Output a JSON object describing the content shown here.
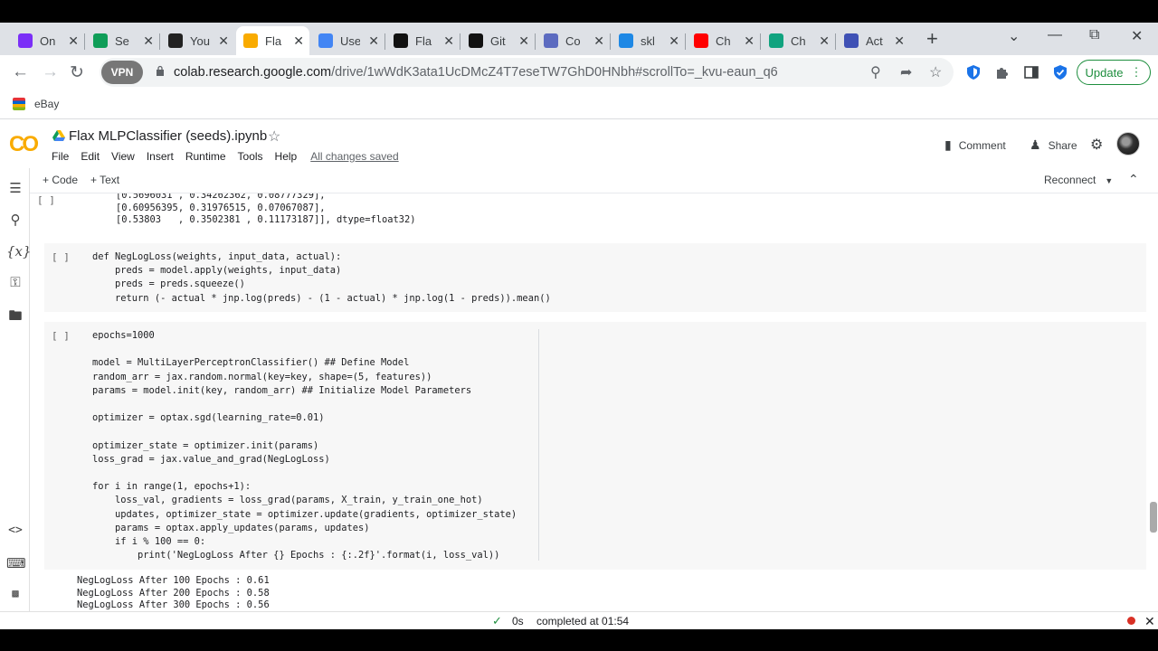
{
  "browser": {
    "tabs": [
      {
        "label": "On",
        "icon": "ublock-icon",
        "color": "#7b2ff7"
      },
      {
        "label": "Se",
        "icon": "google-drive-icon",
        "color": "#0f9d58"
      },
      {
        "label": "You",
        "icon": "camera-icon",
        "color": "#222222"
      },
      {
        "label": "Fla",
        "icon": "colab-icon",
        "color": "#f9ab00",
        "active": true
      },
      {
        "label": "Use",
        "icon": "google-docs-icon",
        "color": "#4285f4"
      },
      {
        "label": "Fla",
        "icon": "black-circle-icon",
        "color": "#111111"
      },
      {
        "label": "Git",
        "icon": "github-icon",
        "color": "#111111"
      },
      {
        "label": "Co",
        "icon": "shield-icon",
        "color": "#5c6bc0"
      },
      {
        "label": "skl",
        "icon": "chart-icon",
        "color": "#1e88e5"
      },
      {
        "label": "Ch",
        "icon": "youtube-icon",
        "color": "#ff0000"
      },
      {
        "label": "Ch",
        "icon": "openai-icon",
        "color": "#10a37f"
      },
      {
        "label": "Act",
        "icon": "gear-flower-icon",
        "color": "#3f51b5"
      }
    ],
    "new_tab_symbol": "+",
    "url_domain": "colab.research.google.com",
    "url_path": "/drive/1wWdK3ata1UcDMcZ4T7eseTW7GhD0HNbh#scrollTo=_kvu-eaun_q6",
    "vpn_label": "VPN",
    "update_label": "Update",
    "bookmark_label": "eBay"
  },
  "colab": {
    "title": "Flax MLPClassifier (seeds).ipynb",
    "menu": [
      "File",
      "Edit",
      "View",
      "Insert",
      "Runtime",
      "Tools",
      "Help"
    ],
    "saved_status": "All changes saved",
    "comment_label": "Comment",
    "share_label": "Share",
    "add_code_label": "+ Code",
    "add_text_label": "+ Text",
    "reconnect_label": "Reconnect"
  },
  "cells": {
    "cell1_output_lines": [
      "[0.5696031 , 0.34262362, 0.08777329],",
      "[0.60956395, 0.31976515, 0.07067087],",
      "[0.53803   , 0.3502381 , 0.11173187]], dtype=float32)"
    ],
    "cell2_code": [
      "def NegLogLoss(weights, input_data, actual):",
      "    preds = model.apply(weights, input_data)",
      "    preds = preds.squeeze()",
      "    return (- actual * jnp.log(preds) - (1 - actual) * jnp.log(1 - preds)).mean()"
    ],
    "cell3_code": [
      "epochs=1000",
      "",
      "model = MultiLayerPerceptronClassifier() ## Define Model",
      "random_arr = jax.random.normal(key=key, shape=(5, features))",
      "params = model.init(key, random_arr) ## Initialize Model Parameters",
      "",
      "optimizer = optax.sgd(learning_rate=0.01)",
      "",
      "optimizer_state = optimizer.init(params)",
      "loss_grad = jax.value_and_grad(NegLogLoss)",
      "",
      "for i in range(1, epochs+1):",
      "    loss_val, gradients = loss_grad(params, X_train, y_train_one_hot)",
      "    updates, optimizer_state = optimizer.update(gradients, optimizer_state)",
      "    params = optax.apply_updates(params, updates)",
      "    if i % 100 == 0:",
      "        print('NegLogLoss After {} Epochs : {:.2f}'.format(i, loss_val))"
    ],
    "cell3_output": [
      "NegLogLoss After 100 Epochs : 0.61",
      "NegLogLoss After 200 Epochs : 0.58",
      "NegLogLoss After 300 Epochs : 0.56"
    ],
    "run_marker": "[ ]"
  },
  "status": {
    "duration": "0s",
    "completed": "completed at 01:54"
  }
}
